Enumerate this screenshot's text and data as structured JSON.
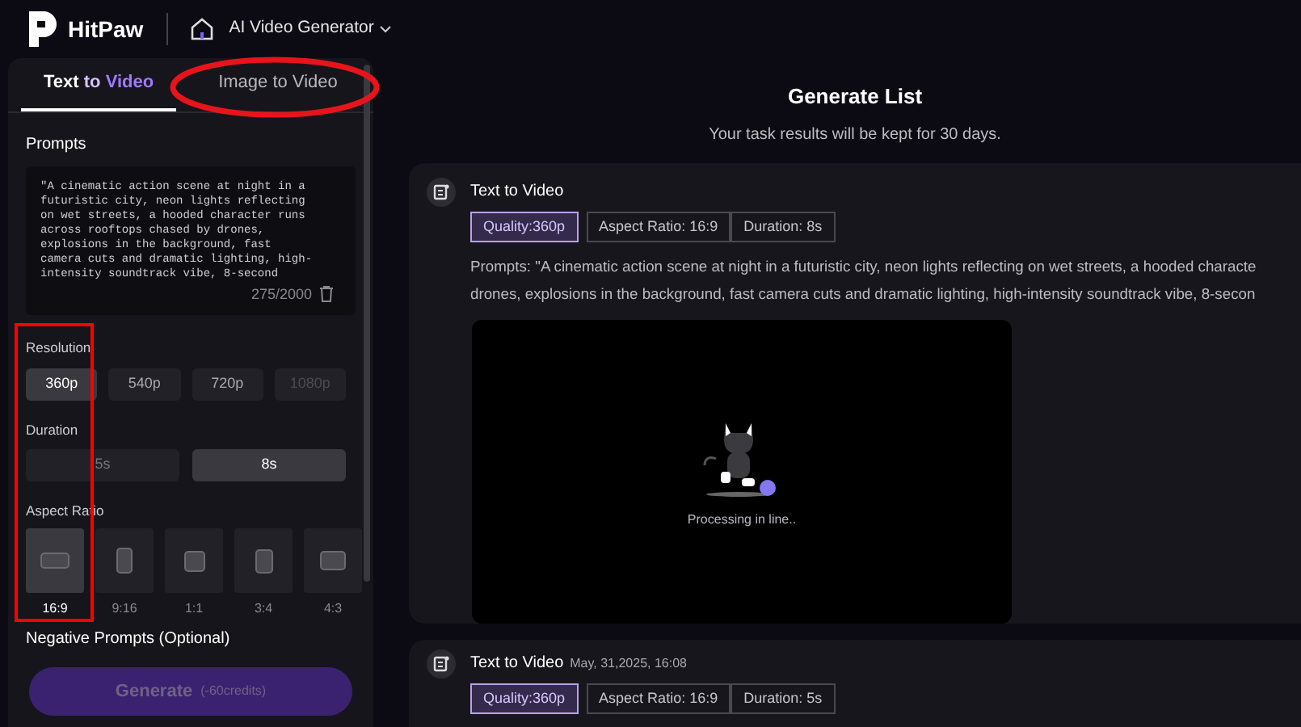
{
  "header": {
    "brand": "HitPaw",
    "app_menu": "AI Video Generator"
  },
  "left_panel": {
    "tabs": [
      {
        "label_parts": [
          "Text ",
          "to ",
          "Video"
        ],
        "selected": true
      },
      {
        "label_parts": [
          "Image to Video"
        ],
        "selected": false
      }
    ],
    "prompts_label": "Prompts",
    "prompt_text": "\"A cinematic action scene at night in a futuristic city, neon lights reflecting on wet streets, a hooded character runs across rooftops chased by drones, explosions in the background, fast camera cuts and dramatic lighting, high-intensity soundtrack vibe, 8-second",
    "prompt_count": "275/2000",
    "resolution": {
      "label": "Resolution",
      "options": [
        {
          "label": "360p",
          "selected": true,
          "disabled": false
        },
        {
          "label": "540p",
          "selected": false,
          "disabled": false
        },
        {
          "label": "720p",
          "selected": false,
          "disabled": false
        },
        {
          "label": "1080p",
          "selected": false,
          "disabled": true
        }
      ]
    },
    "duration": {
      "label": "Duration",
      "options": [
        {
          "label": "5s",
          "selected": false
        },
        {
          "label": "8s",
          "selected": true
        }
      ]
    },
    "aspect_ratio": {
      "label": "Aspect Ratio",
      "options": [
        {
          "label": "16:9",
          "selected": true,
          "kind": "wide"
        },
        {
          "label": "9:16",
          "selected": false,
          "kind": "tall"
        },
        {
          "label": "1:1",
          "selected": false,
          "kind": "square"
        },
        {
          "label": "3:4",
          "selected": false,
          "kind": "portrait"
        },
        {
          "label": "4:3",
          "selected": false,
          "kind": "landscape"
        }
      ]
    },
    "negative_prompts_label": "Negative Prompts (Optional)",
    "generate_button": {
      "label": "Generate",
      "credits": "(-60credits)",
      "disabled": true
    }
  },
  "generate_list": {
    "title": "Generate List",
    "subtitle": "Your task results will be kept for 30 days.",
    "tasks": [
      {
        "title": "Text to Video",
        "tags": [
          {
            "label": "Quality:360p",
            "selected": true
          },
          {
            "label": "Aspect Ratio: 16:9",
            "selected": false
          },
          {
            "label": "Duration: 8s",
            "selected": false
          }
        ],
        "prompt_lines": [
          "Prompts:  \"A cinematic action scene at night in a futuristic city, neon lights reflecting on wet streets, a hooded characte",
          "drones, explosions in the background, fast camera cuts and dramatic lighting, high-intensity soundtrack vibe, 8-secon"
        ],
        "status": "Processing in line.."
      },
      {
        "title": "Text to Video",
        "date": "May, 31,2025, 16:08",
        "tags": [
          {
            "label": "Quality:360p",
            "selected": true
          },
          {
            "label": "Aspect Ratio: 16:9",
            "selected": false
          },
          {
            "label": "Duration: 5s",
            "selected": false
          }
        ]
      }
    ]
  }
}
